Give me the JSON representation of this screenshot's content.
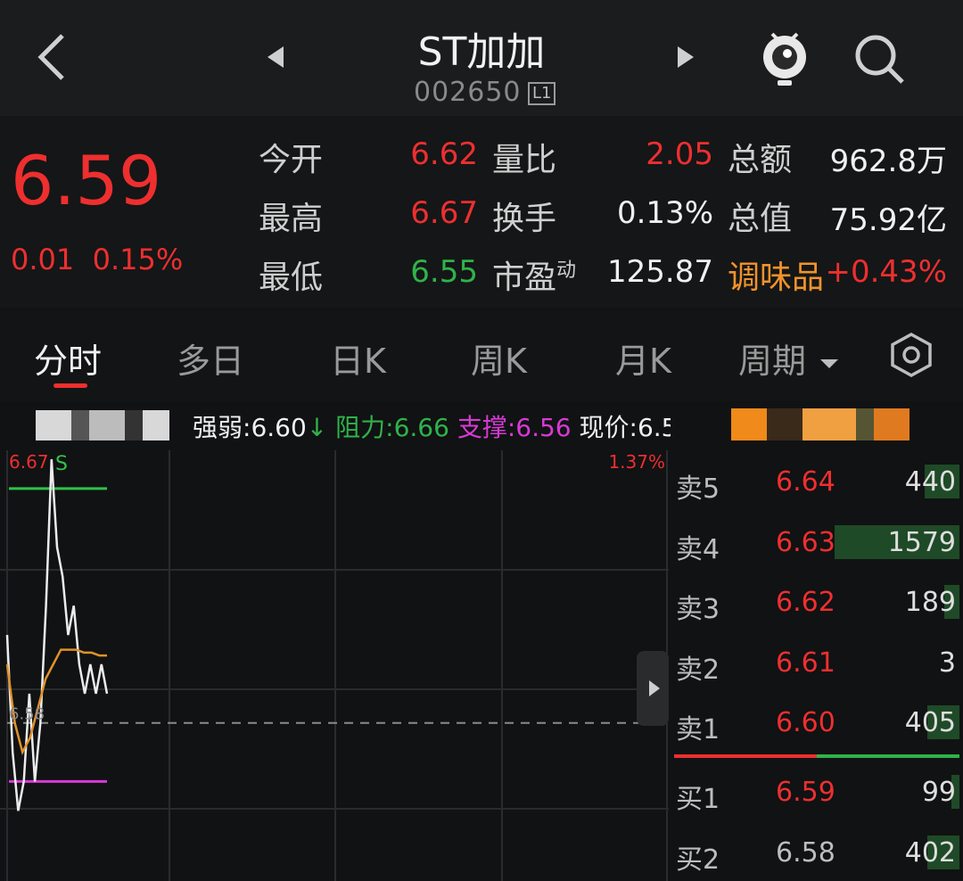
{
  "header": {
    "title": "ST加加",
    "code": "002650",
    "level_badge": "L1",
    "icons": [
      "back-icon",
      "prev-stock-icon",
      "next-stock-icon",
      "mascot-icon",
      "search-icon"
    ]
  },
  "quote": {
    "price": "6.59",
    "change": "0.01",
    "change_pct": "0.15%",
    "stats": {
      "open_label": "今开",
      "open": "6.62",
      "high_label": "最高",
      "high": "6.67",
      "low_label": "最低",
      "low": "6.55",
      "vol_ratio_label": "量比",
      "vol_ratio": "2.05",
      "turnover_label": "换手",
      "turnover": "0.13%",
      "pe_label": "市盈",
      "pe_sup": "动",
      "pe": "125.87",
      "amount_label": "总额",
      "amount": "962.8万",
      "mktcap_label": "总值",
      "mktcap": "75.92亿",
      "sector": "调味品",
      "sector_pct": "+0.43%"
    }
  },
  "tabs": [
    {
      "label": "分时",
      "active": true
    },
    {
      "label": "多日"
    },
    {
      "label": "日K"
    },
    {
      "label": "周K"
    },
    {
      "label": "月K"
    },
    {
      "label": "周期"
    }
  ],
  "indicators": {
    "strength_label": "强弱:",
    "strength": "6.60",
    "resist_label": "阻力:",
    "resist": "6.66",
    "support_label": "支撑:",
    "support": "6.56",
    "now_label": "现价:",
    "now": "6.5"
  },
  "chart_data": {
    "type": "line",
    "top_left_label": "6.67",
    "top_right_label": "1.37%",
    "base_label": "6.58",
    "marker": "S",
    "series": [
      {
        "values": [
          6.61,
          6.57,
          6.55,
          6.56,
          6.59,
          6.56,
          6.58,
          6.62,
          6.67,
          6.64,
          6.63,
          6.61,
          6.62,
          6.6,
          6.59,
          6.6,
          6.59,
          6.6,
          6.59
        ]
      },
      {
        "values": [
          6.6,
          6.58,
          6.57,
          6.575,
          6.585,
          6.595,
          6.6,
          6.605,
          6.605,
          6.605,
          6.604,
          6.604,
          6.603,
          6.603
        ]
      }
    ],
    "reference_lines": {
      "resistance": 6.66,
      "support": 6.56,
      "prev_close": 6.58
    },
    "ylim": [
      6.53,
      6.67
    ]
  },
  "order_book": {
    "asks": [
      {
        "label": "卖5",
        "price": "6.64",
        "vol": "440",
        "vol_num": 440
      },
      {
        "label": "卖4",
        "price": "6.63",
        "vol": "1579",
        "vol_num": 1579
      },
      {
        "label": "卖3",
        "price": "6.62",
        "vol": "189",
        "vol_num": 189
      },
      {
        "label": "卖2",
        "price": "6.61",
        "vol": "3",
        "vol_num": 3
      },
      {
        "label": "卖1",
        "price": "6.60",
        "vol": "405",
        "vol_num": 405
      }
    ],
    "bids": [
      {
        "label": "买1",
        "price": "6.59",
        "vol": "99",
        "vol_num": 99
      },
      {
        "label": "买2",
        "price": "6.58",
        "vol": "402",
        "vol_num": 402
      }
    ],
    "colors": {
      "up": "#ee2f2f",
      "down": "#2fb34a",
      "bar": "#1f4a27"
    }
  }
}
